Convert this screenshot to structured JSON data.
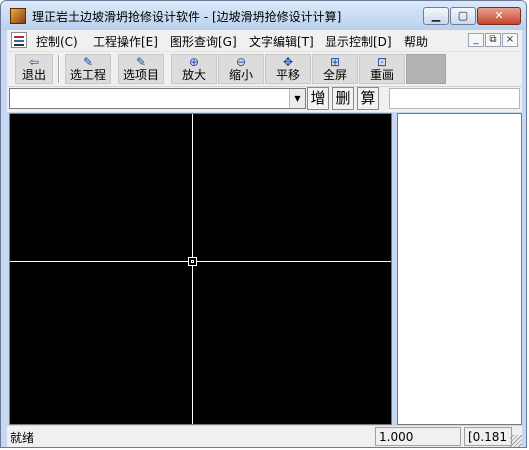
{
  "window": {
    "title": "理正岩土边坡滑坍抢修设计软件 - [边坡滑坍抢修设计计算]",
    "minimize_glyph": "▁",
    "maximize_glyph": "▢",
    "close_glyph": "✕"
  },
  "menu": {
    "items": [
      "控制(C)",
      "工程操作[E]",
      "图形查询[G]",
      "文字编辑[T]",
      "显示控制[D]",
      "帮助"
    ],
    "mdi_minimize": "_",
    "mdi_restore": "⧉",
    "mdi_close": "×"
  },
  "toolbar": {
    "buttons": [
      {
        "label": "退出",
        "icon": "exit-arrow-icon",
        "glyph": "⇦"
      },
      {
        "label": "选工程",
        "icon": "edit-project-icon",
        "glyph": "✎"
      },
      {
        "label": "选项目",
        "icon": "edit-item-icon",
        "glyph": "✎"
      },
      {
        "label": "放大",
        "icon": "zoom-in-icon",
        "glyph": "⊕"
      },
      {
        "label": "缩小",
        "icon": "zoom-out-icon",
        "glyph": "⊖"
      },
      {
        "label": "平移",
        "icon": "pan-icon",
        "glyph": "✥"
      },
      {
        "label": "全屏",
        "icon": "fullscreen-icon",
        "glyph": "⊞"
      },
      {
        "label": "重画",
        "icon": "redraw-icon",
        "glyph": "⊡"
      }
    ]
  },
  "command_bar": {
    "combo_value": "",
    "add_label": "增",
    "delete_label": "删",
    "calc_label": "算",
    "field_value": ""
  },
  "status": {
    "message": "就绪",
    "scale": "1.000",
    "coords": "[0.181"
  }
}
